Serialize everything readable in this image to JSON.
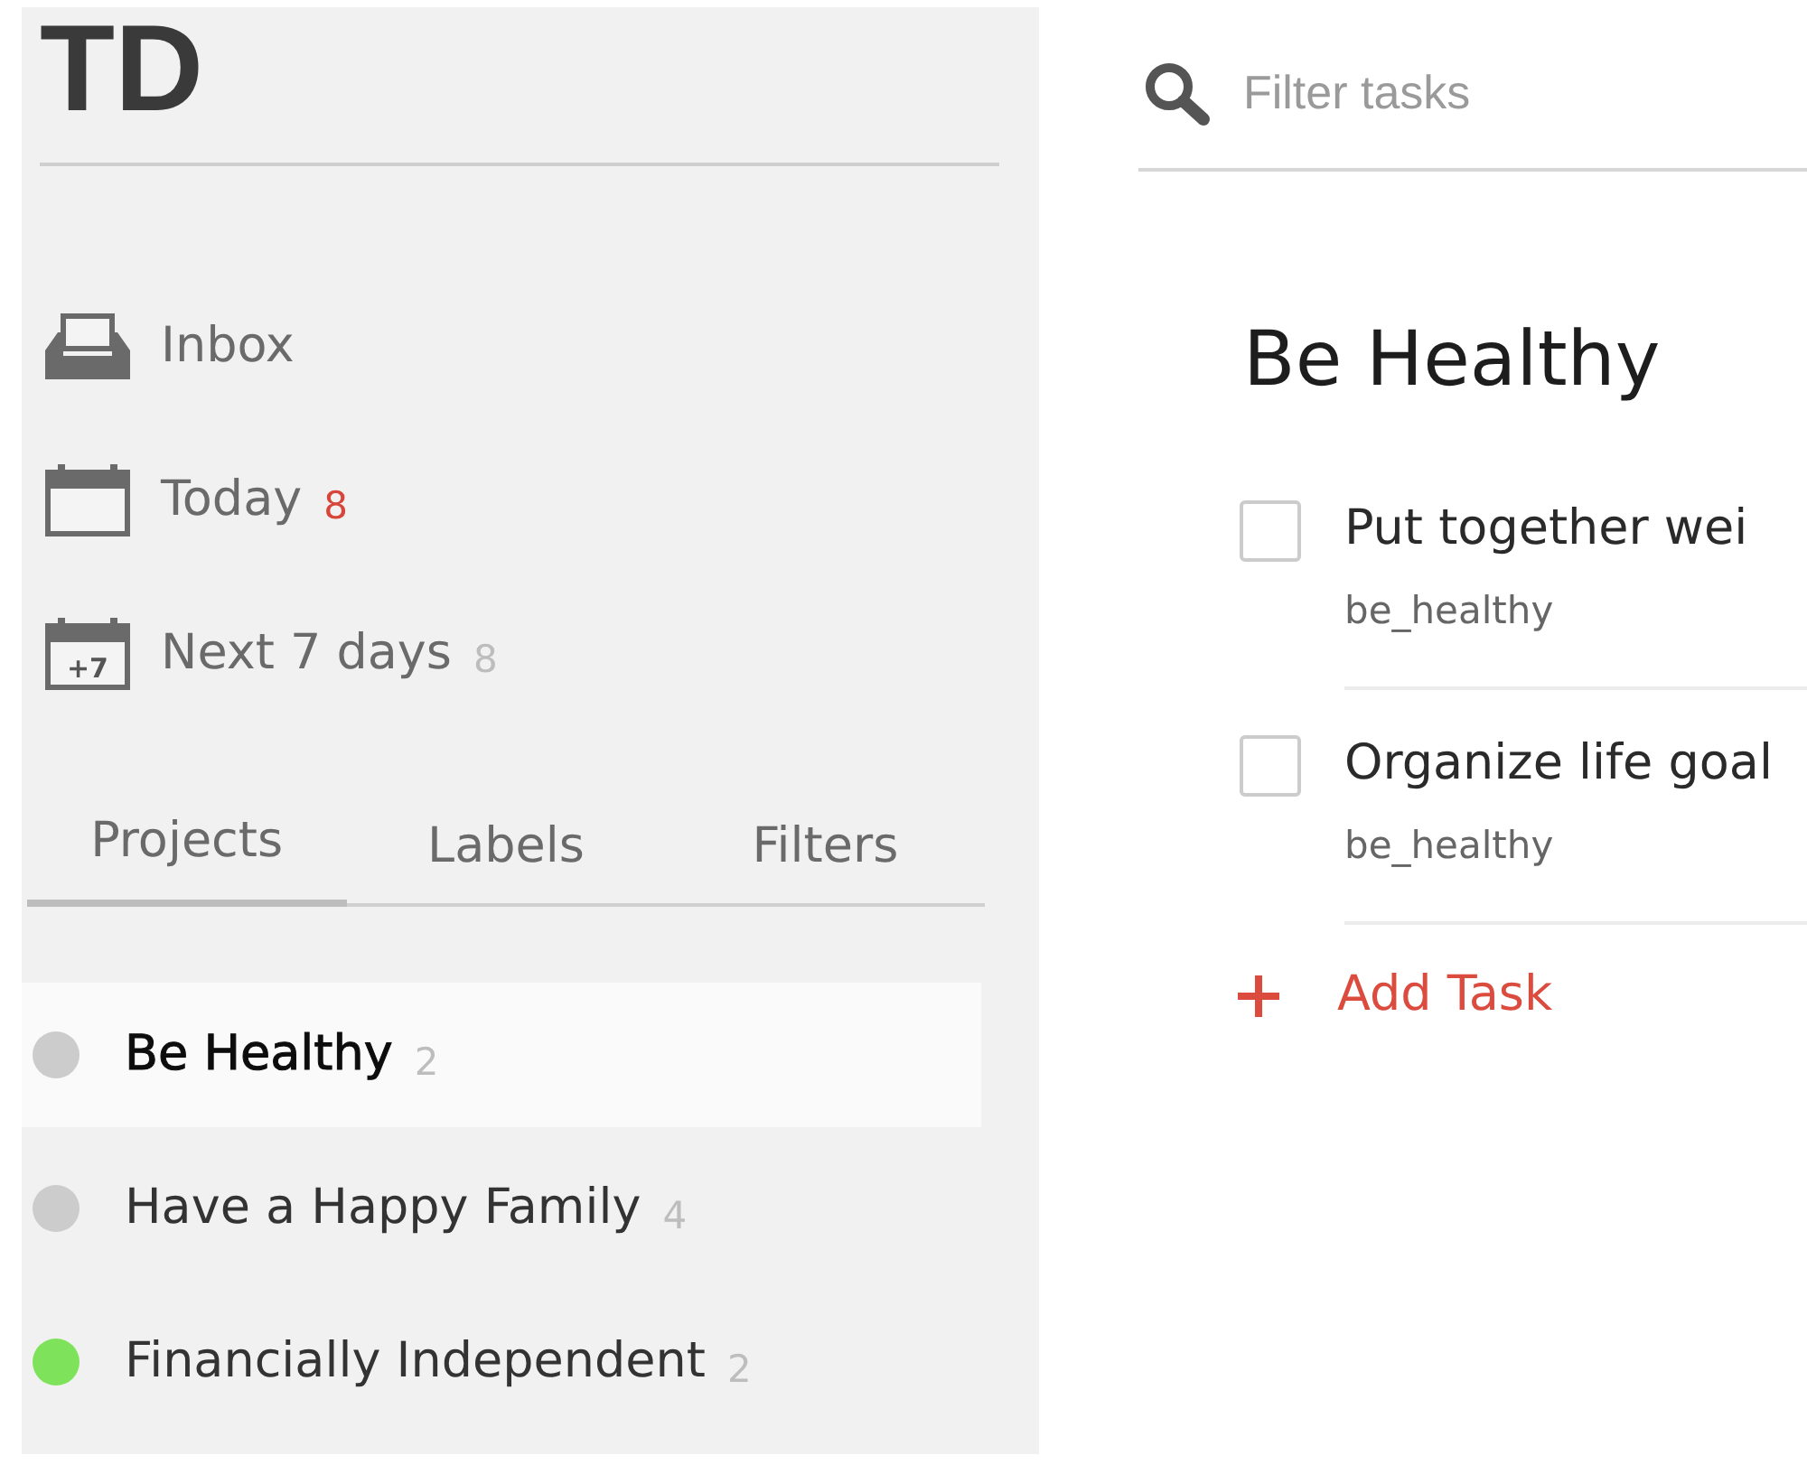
{
  "sidebar": {
    "logo": "TD",
    "nav": [
      {
        "kind": "inbox",
        "label": "Inbox"
      },
      {
        "kind": "calendar",
        "label": "Today",
        "count": "8",
        "count_alert": true
      },
      {
        "kind": "week",
        "icon_text": "+7",
        "label": "Next 7 days",
        "count": "8",
        "count_alert": false
      }
    ],
    "tabs": [
      {
        "label": "Projects",
        "selected": true
      },
      {
        "label": "Labels",
        "selected": false
      },
      {
        "label": "Filters",
        "selected": false
      }
    ],
    "projects": [
      {
        "name": "Be Healthy",
        "count": "2",
        "color": "#cccccc",
        "selected": true
      },
      {
        "name": "Have a Happy Family",
        "count": "4",
        "color": "#cccccc",
        "selected": false
      },
      {
        "name": "Financially Independent",
        "count": "2",
        "color": "#7ee35a",
        "selected": false
      }
    ]
  },
  "search": {
    "placeholder": "Filter tasks"
  },
  "main": {
    "title": "Be Healthy",
    "tasks": [
      {
        "title": "Put together wei",
        "project": "be_healthy",
        "checked": false
      },
      {
        "title": "Organize life goal",
        "project": "be_healthy",
        "checked": false
      }
    ],
    "add_task": "Add Task"
  }
}
